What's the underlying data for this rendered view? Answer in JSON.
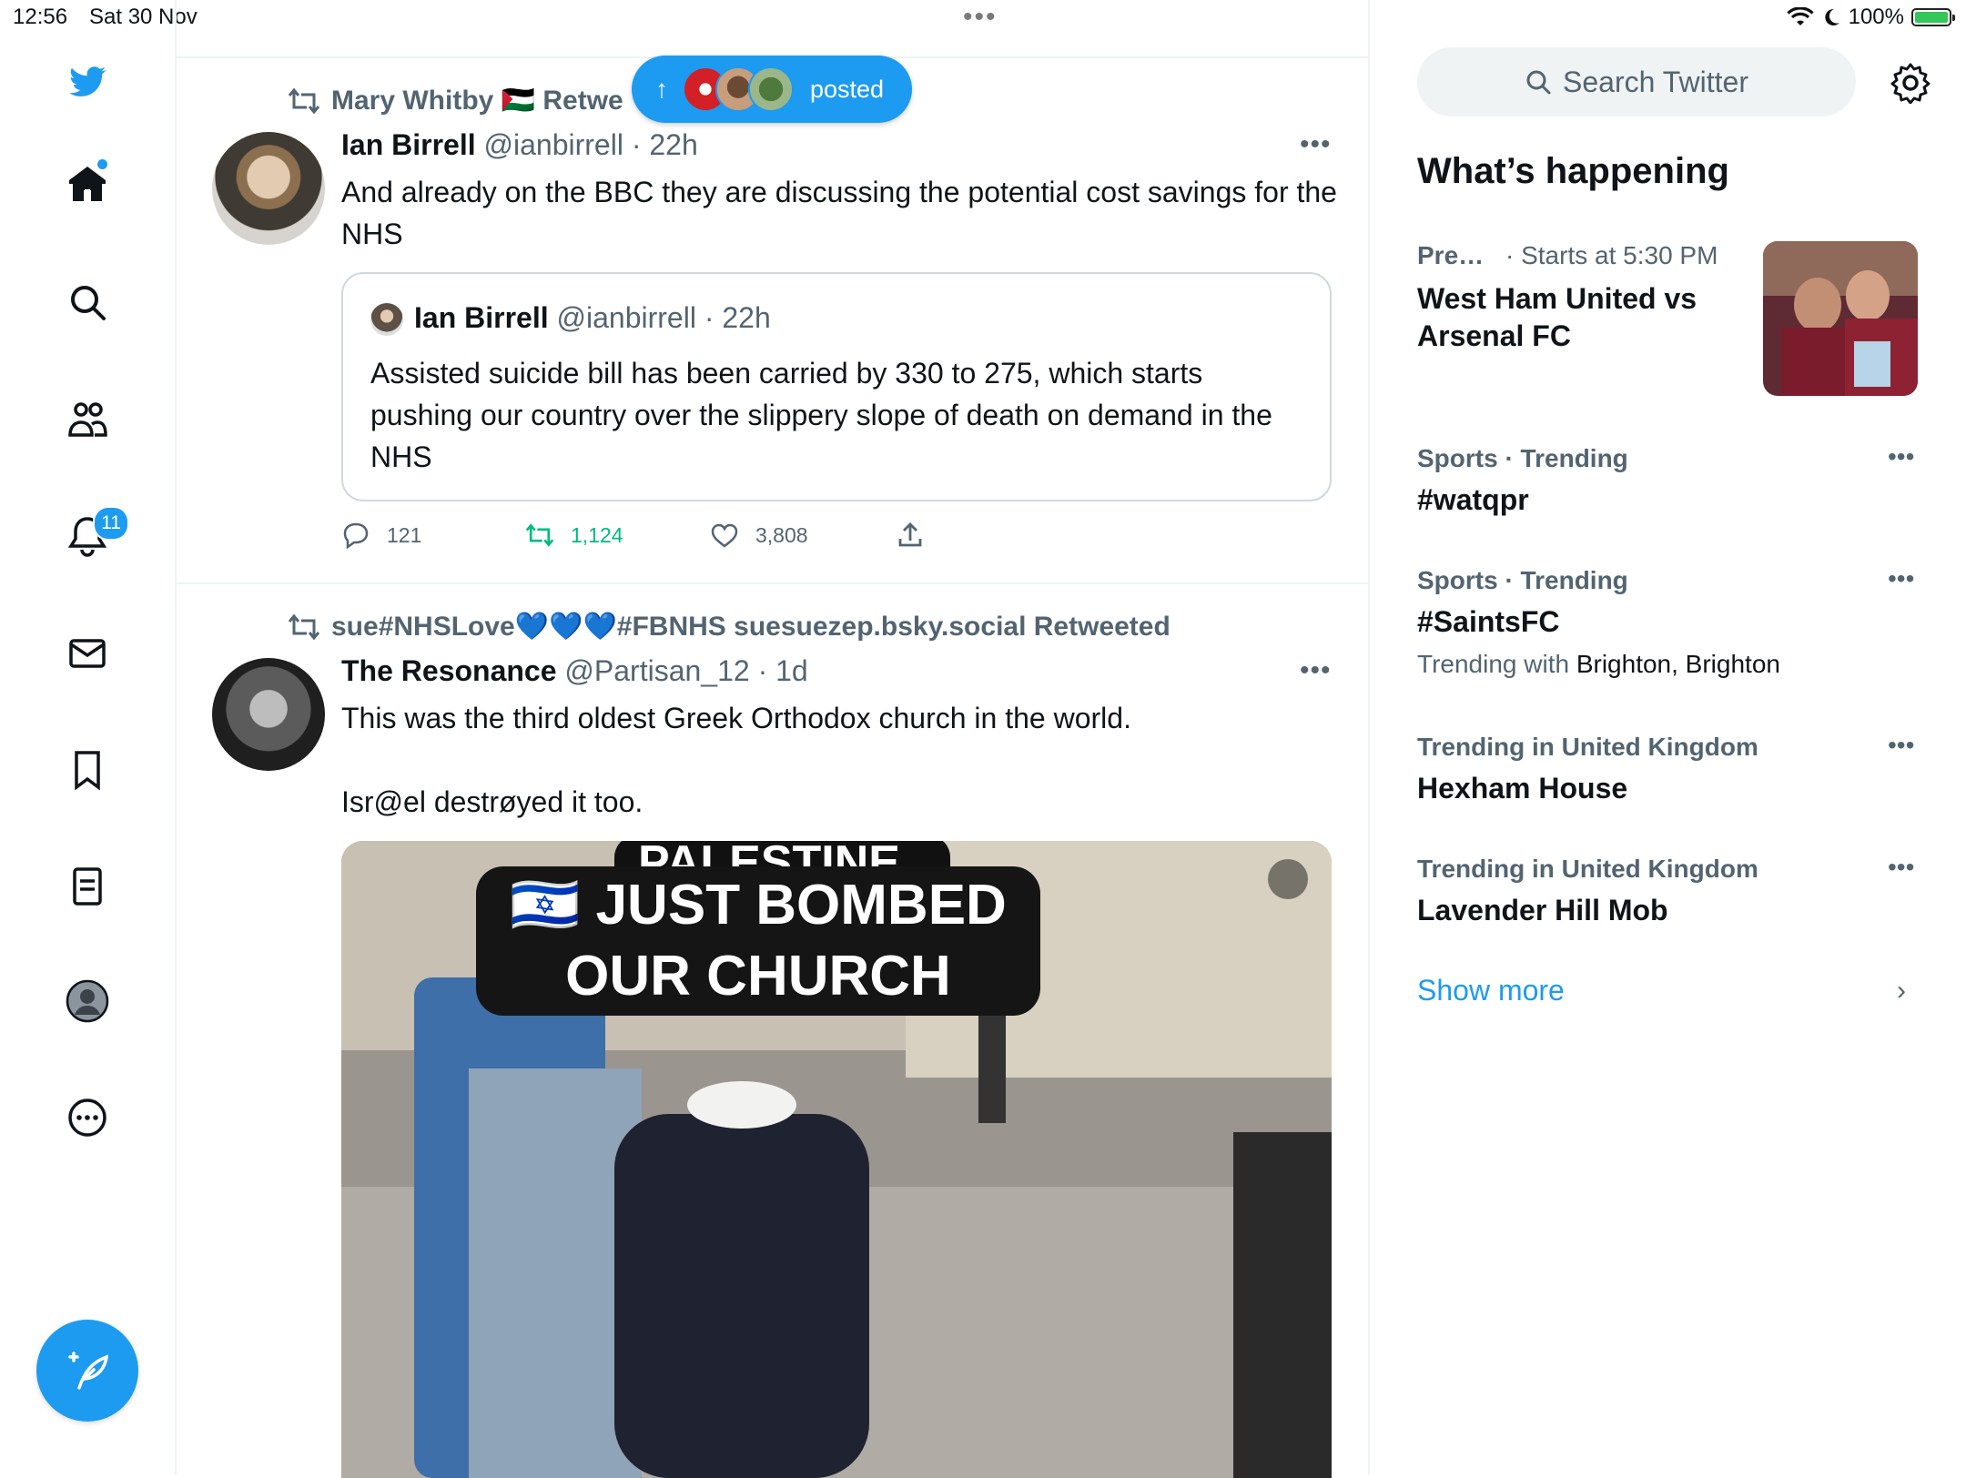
{
  "status_bar": {
    "time": "12:56",
    "date": "Sat 30 Nov",
    "battery": "100%"
  },
  "nav": {
    "notifications_badge": "11"
  },
  "new_posts_pill": {
    "label": "posted"
  },
  "tweets": [
    {
      "retweet_by": "Mary Whitby 🇵🇸 Retwe",
      "author_name": "Ian Birrell",
      "author_meta": "@ianbirrell · 22h",
      "text": "And already on the BBC they are discussing the potential cost savings for the NHS",
      "quote": {
        "author_name": "Ian Birrell",
        "author_meta": "@ianbirrell · 22h",
        "text": "Assisted suicide bill has been carried by 330 to 275, which starts pushing our country over the slippery slope of death on demand in the NHS"
      },
      "actions": {
        "replies": "121",
        "retweets": "1,124",
        "likes": "3,808"
      }
    },
    {
      "retweet_by": "sue#NHSLove💙💙💙#FBNHS suesuezep.bsky.social Retweeted",
      "author_name": "The Resonance",
      "author_meta": "@Partisan_12 · 1d",
      "text_line1": "This was the third oldest Greek Orthodox church in the world.",
      "text_line2": "Isr@el destrøyed it too.",
      "media_caption_top": "PALESTINE .",
      "media_caption_main": "🇮🇱 JUST BOMBED OUR CHURCH"
    }
  ],
  "sidebar": {
    "search_placeholder": "Search Twitter",
    "title": "What’s happening",
    "event": {
      "meta_left": "Pre…",
      "meta_right": "· Starts at 5:30 PM",
      "name": "West Ham United vs Arsenal FC"
    },
    "trends": [
      {
        "meta": "Sports · Trending",
        "name": "#watqpr",
        "extra_label": "",
        "extra_value": ""
      },
      {
        "meta": "Sports · Trending",
        "name": "#SaintsFC",
        "extra_label": "Trending with ",
        "extra_value": "Brighton, Brighton"
      },
      {
        "meta": "Trending in United Kingdom",
        "name": "Hexham House",
        "extra_label": "",
        "extra_value": ""
      },
      {
        "meta": "Trending in United Kingdom",
        "name": "Lavender Hill Mob",
        "extra_label": "",
        "extra_value": ""
      }
    ],
    "show_more": "Show more"
  },
  "colors": {
    "accent": "#1d9bf0",
    "retweet_green": "#00ba7c",
    "text": "#0f1419",
    "secondary": "#536471"
  },
  "icons": [
    "twitter-bird-icon",
    "home-icon",
    "search-icon",
    "communities-icon",
    "notifications-icon",
    "messages-icon",
    "bookmark-icon",
    "lists-icon",
    "profile-icon",
    "more-icon",
    "compose-icon",
    "retweet-icon",
    "reply-icon",
    "like-icon",
    "share-icon",
    "gear-icon",
    "chevron-right-icon"
  ]
}
